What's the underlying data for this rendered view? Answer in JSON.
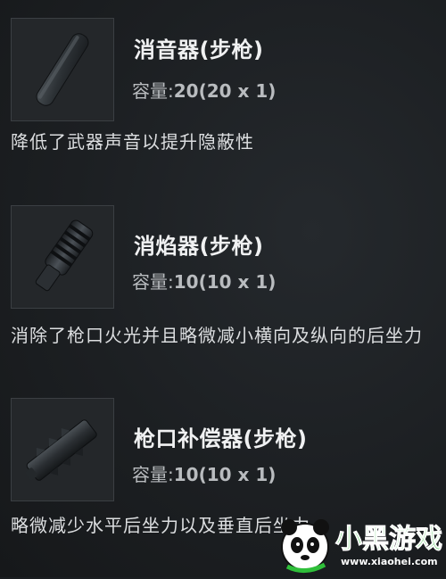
{
  "items": [
    {
      "title": "消音器(步枪)",
      "capacity_label": "容量:",
      "capacity_value": "20(20 x 1)",
      "description": "降低了武器声音以提升隐蔽性",
      "icon": "suppressor-icon"
    },
    {
      "title": "消焰器(步枪)",
      "capacity_label": "容量:",
      "capacity_value": "10(10 x 1)",
      "description": "消除了枪口火光并且略微减小横向及纵向的后坐力",
      "icon": "flash-hider-icon"
    },
    {
      "title": "枪口补偿器(步枪)",
      "capacity_label": "容量:",
      "capacity_value": "10(10 x 1)",
      "description": "略微减少水平后坐力以及垂直后坐力",
      "icon": "compensator-icon"
    }
  ],
  "watermark": {
    "brand": "小黑游戏",
    "url": "www.xiaohei.com",
    "icon": "panda-logo-icon"
  },
  "colors": {
    "background": "#1b1e21",
    "text": "#e2e4e6",
    "muted": "#b9bcbf",
    "watermark_green": "#2fbf3a"
  }
}
